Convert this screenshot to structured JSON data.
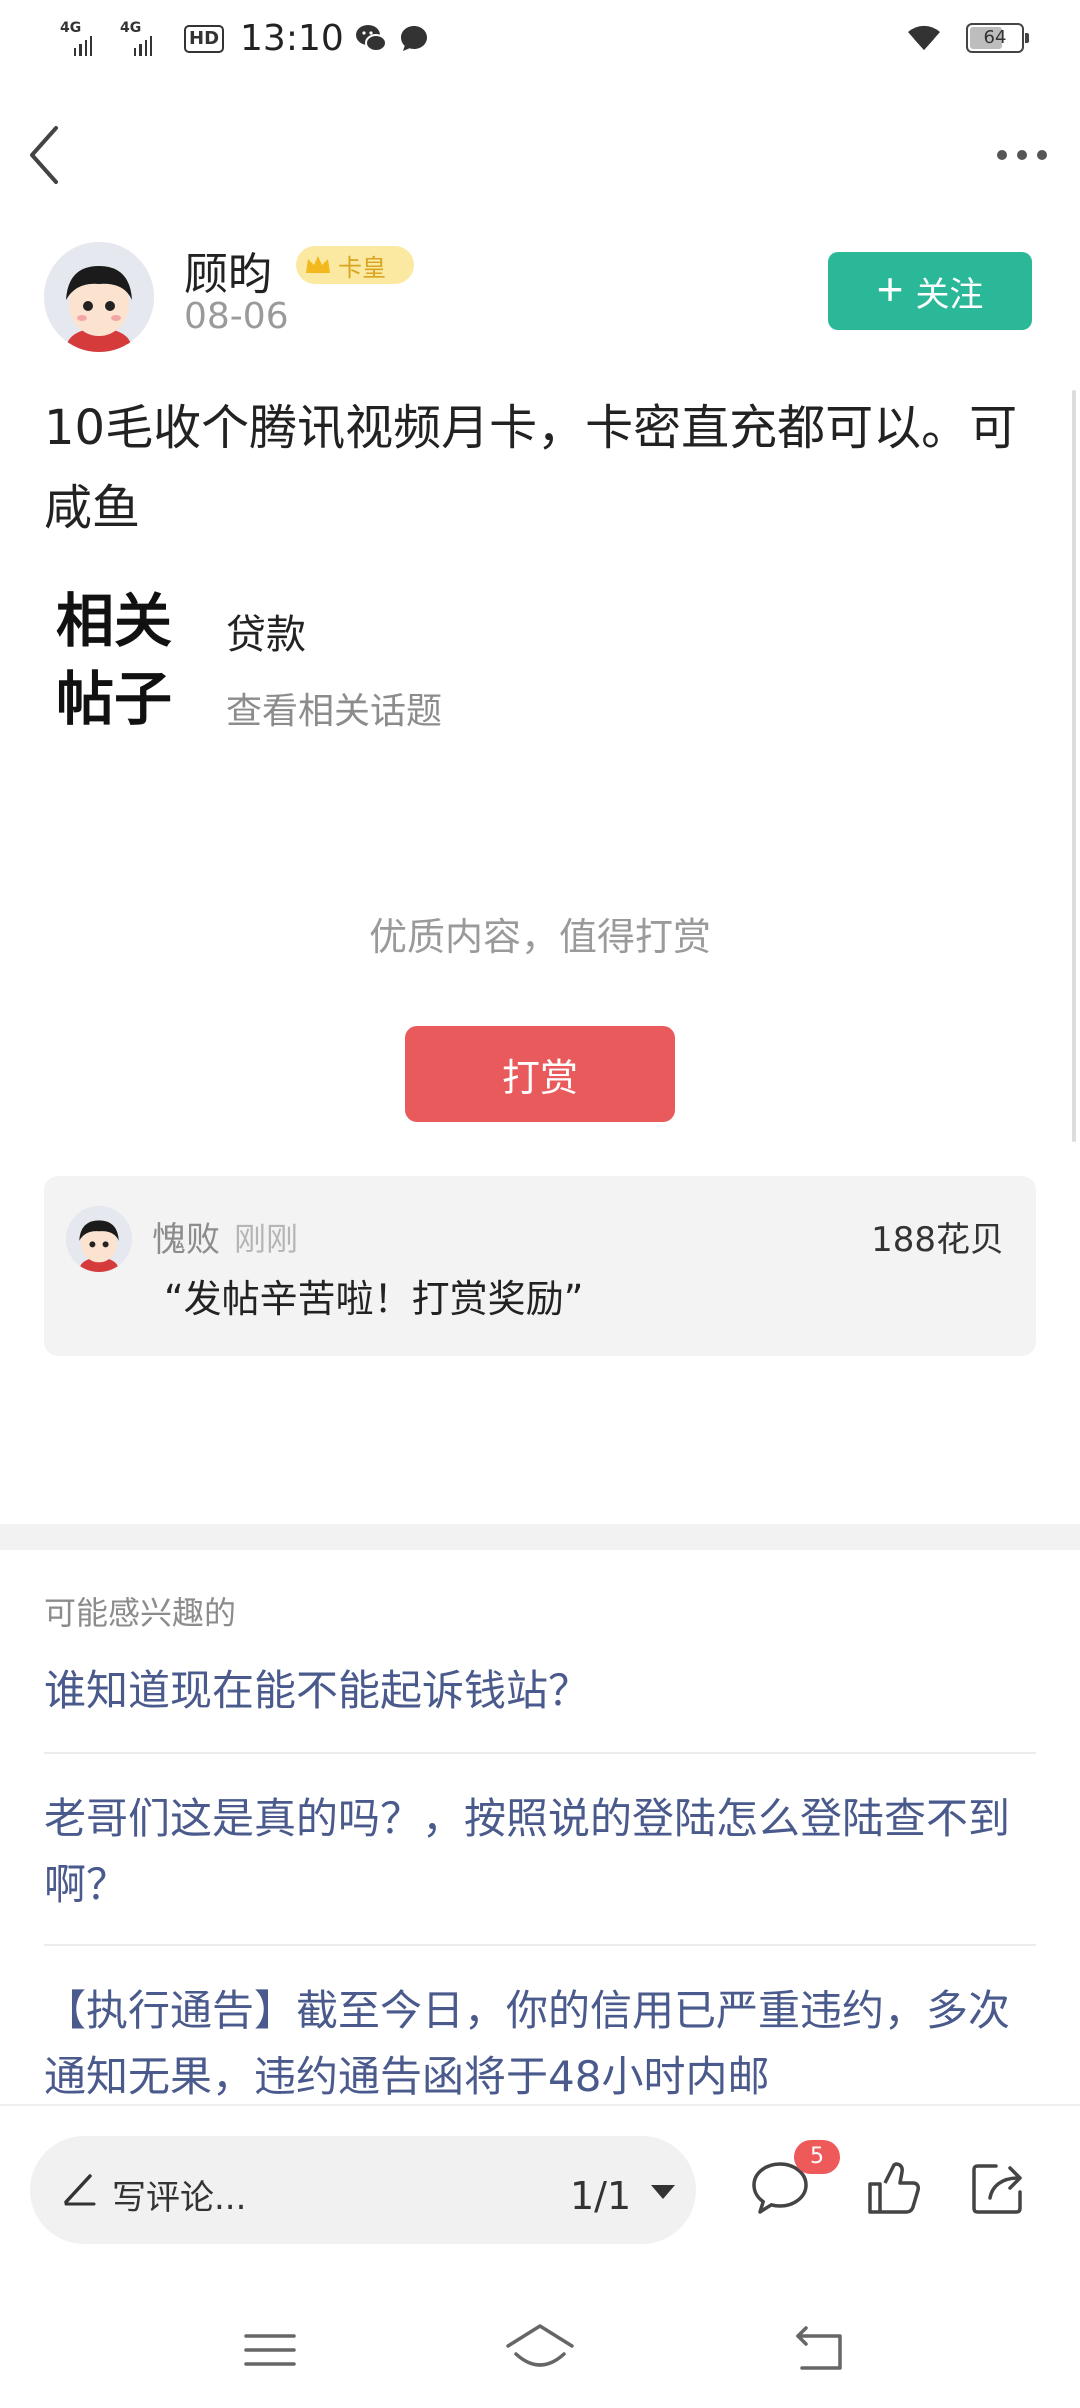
{
  "status_bar": {
    "signal1": "4G",
    "signal2": "4G",
    "hd": "HD",
    "time": "13:10",
    "battery": "64"
  },
  "post": {
    "author": {
      "name": "顾昀",
      "badge": "卡皇",
      "date": "08-06"
    },
    "follow_label": "关注",
    "content": "10毛收个腾讯视频月卡，卡密直充都可以。可咸鱼",
    "related": {
      "title": "相关帖子",
      "tag": "贷款",
      "link": "查看相关话题"
    },
    "reward": {
      "prompt": "优质内容，值得打赏",
      "button_label": "打赏",
      "record": {
        "user": "愧败",
        "time": "刚刚",
        "amount": "188花贝",
        "message": "“发帖辛苦啦！打赏奖励”"
      }
    }
  },
  "recommendations": {
    "title": "可能感兴趣的",
    "items": [
      "谁知道现在能不能起诉钱站？",
      "老哥们这是真的吗？，按照说的登陆怎么登陆查不到啊？",
      "【执行通告】截至今日，你的信用已严重违约，多次通知无果，违约通告函将于48小时内邮"
    ]
  },
  "bottom_bar": {
    "comment_placeholder": "写评论...",
    "page_indicator": "1/1",
    "comment_count": "5"
  },
  "colors": {
    "accent_green": "#2ab899",
    "reward_red": "#e85a5b",
    "badge_red": "#ee5a5a",
    "link_blue": "#4a5a8c"
  },
  "icons": [
    "back-arrow-icon",
    "more-dots-icon",
    "plus-icon",
    "crown-icon",
    "pen-icon",
    "caret-down-icon",
    "comment-bubble-icon",
    "thumbs-up-icon",
    "share-icon",
    "menu-icon",
    "home-icon",
    "back-nav-icon"
  ]
}
